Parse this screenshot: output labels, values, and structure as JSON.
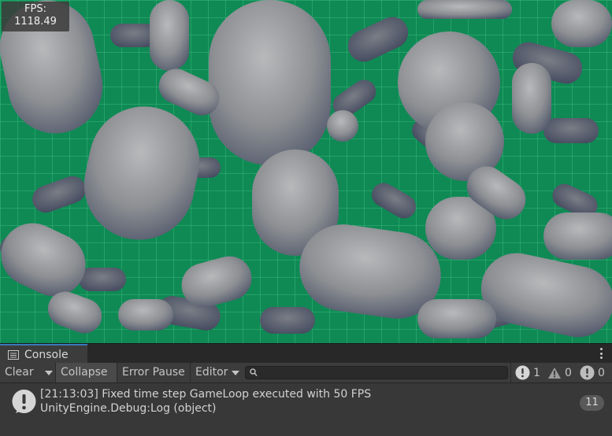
{
  "viewport": {
    "fps_label": "FPS:",
    "fps_value": "1118.49"
  },
  "console": {
    "tab_label": "Console",
    "toolbar": {
      "clear": "Clear",
      "collapse": "Collapse",
      "error_pause": "Error Pause",
      "editor": "Editor",
      "search_value": ""
    },
    "counts": {
      "info": "1",
      "warning": "0",
      "error": "0"
    },
    "log": {
      "line1": "[21:13:03] Fixed time step GameLoop executed with 50 FPS",
      "line2": "UnityEngine.Debug:Log (object)",
      "count": "11"
    }
  },
  "colors": {
    "ground": "#0c7a4b",
    "capsule": "#8a8c90",
    "accent_tab": "#3a79bb"
  }
}
